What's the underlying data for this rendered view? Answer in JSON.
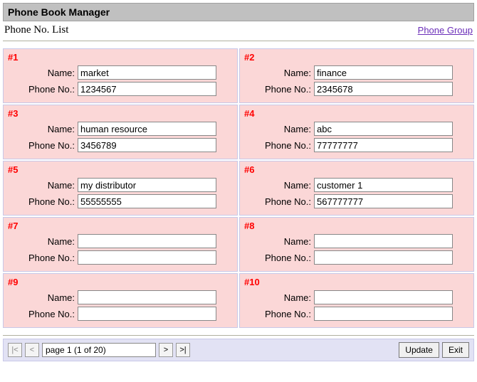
{
  "title": "Phone Book Manager",
  "subtitle": "Phone No. List",
  "link_label": "Phone Group",
  "labels": {
    "name": "Name:",
    "phone": "Phone No.:"
  },
  "entries": [
    {
      "num": "#1",
      "name": "market",
      "phone": "1234567"
    },
    {
      "num": "#2",
      "name": "finance",
      "phone": "2345678"
    },
    {
      "num": "#3",
      "name": "human resource",
      "phone": "3456789"
    },
    {
      "num": "#4",
      "name": "abc",
      "phone": "77777777"
    },
    {
      "num": "#5",
      "name": "my distributor",
      "phone": "55555555"
    },
    {
      "num": "#6",
      "name": "customer 1",
      "phone": "567777777"
    },
    {
      "num": "#7",
      "name": "",
      "phone": ""
    },
    {
      "num": "#8",
      "name": "",
      "phone": ""
    },
    {
      "num": "#9",
      "name": "",
      "phone": ""
    },
    {
      "num": "#10",
      "name": "",
      "phone": ""
    }
  ],
  "pager": {
    "first": "|<",
    "prev": "<",
    "next": ">",
    "last": ">|",
    "page_text": "page 1 (1 of 20)"
  },
  "buttons": {
    "update": "Update",
    "exit": "Exit"
  }
}
